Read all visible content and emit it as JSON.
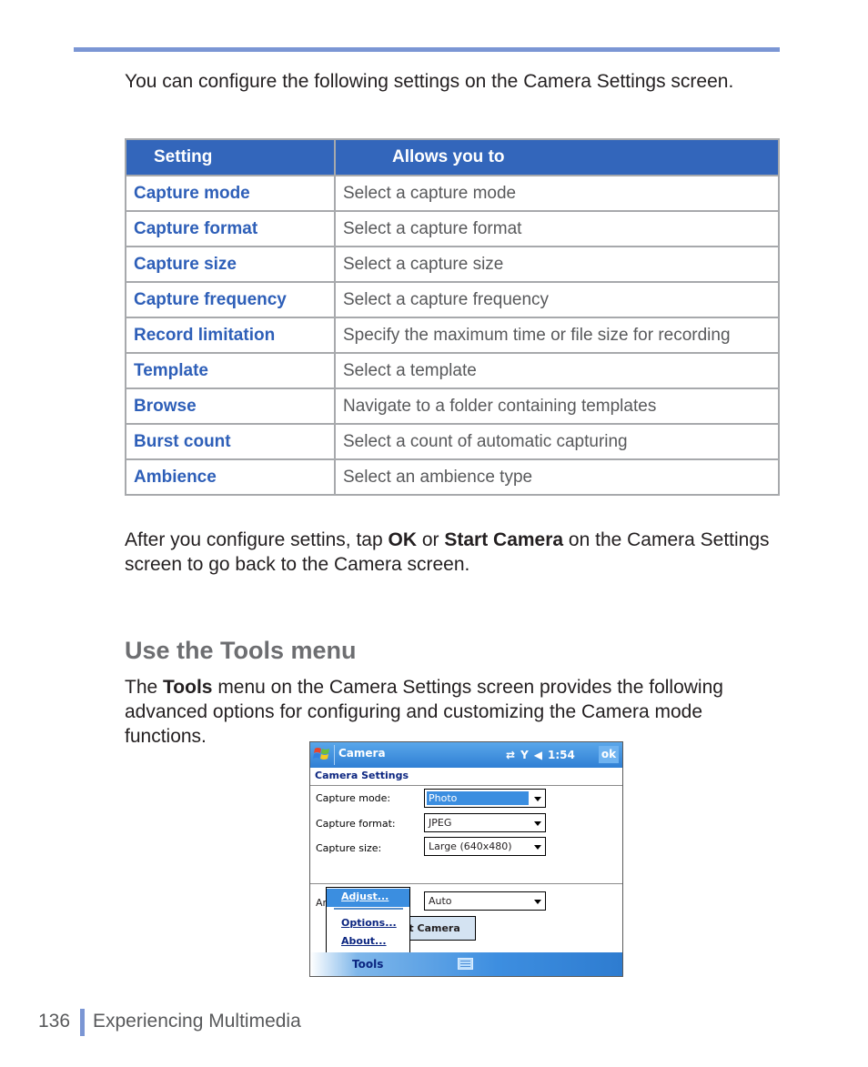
{
  "intro": "You can configure the following settings on the Camera Settings screen.",
  "table": {
    "headers": [
      "Setting",
      "Allows you to"
    ],
    "rows": [
      {
        "setting": "Capture mode",
        "desc": "Select a capture mode"
      },
      {
        "setting": "Capture format",
        "desc": "Select a capture format"
      },
      {
        "setting": "Capture size",
        "desc": "Select a capture size"
      },
      {
        "setting": "Capture frequency",
        "desc": "Select a capture frequency"
      },
      {
        "setting": "Record limitation",
        "desc": "Specify the maximum time or file size for recording"
      },
      {
        "setting": "Template",
        "desc": "Select a template"
      },
      {
        "setting": "Browse",
        "desc": "Navigate to a folder containing templates"
      },
      {
        "setting": "Burst count",
        "desc": "Select a count of automatic capturing"
      },
      {
        "setting": "Ambience",
        "desc": "Select an ambience type"
      }
    ]
  },
  "after": {
    "pre": "After you configure settins, tap ",
    "ok": "OK",
    "mid": " or ",
    "start": "Start Camera",
    "post": " on the Camera Settings screen to go back to the Camera screen."
  },
  "section": {
    "heading": "Use the Tools menu",
    "pre": "The ",
    "bold": "Tools",
    "post": " menu on the Camera Settings screen provides the following advanced options for configuring and customizing the Camera mode functions."
  },
  "device": {
    "title": "Camera",
    "time": "1:54",
    "ok": "ok",
    "header": "Camera Settings",
    "fields": [
      {
        "label": "Capture mode:",
        "value": "Photo",
        "selected": true
      },
      {
        "label": "Capture format:",
        "value": "JPEG"
      },
      {
        "label": "Capture size:",
        "value": "Large (640x480)"
      }
    ],
    "ambience_label_partial": "An",
    "ambience_value": "Auto",
    "start_camera_partial": "rt Camera",
    "menu": [
      "Adjust...",
      "Options...",
      "About..."
    ],
    "tools": "Tools",
    "accent": "#3b8ee0"
  },
  "footer": {
    "page": "136",
    "chapter": "Experiencing Multimedia"
  }
}
